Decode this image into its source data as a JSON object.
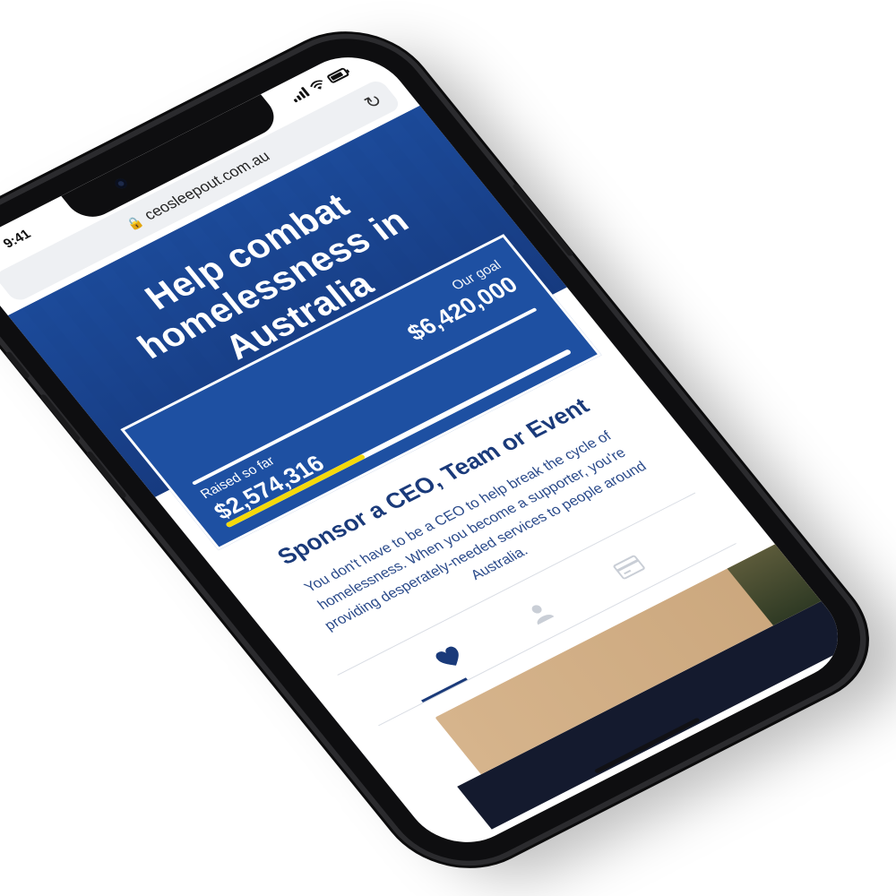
{
  "status_bar": {
    "time": "9:41"
  },
  "browser": {
    "url": "ceosleepout.com.au"
  },
  "hero": {
    "title": "Help combat homelessness in Australia"
  },
  "fundraising": {
    "goal_label": "Our goal",
    "goal_value": "$6,420,000",
    "raised_label": "Raised so far",
    "raised_value": "$2,574,316",
    "progress_fraction": 0.401,
    "progress_color": "#f5d90a",
    "card_color": "#1e50a2"
  },
  "sponsor": {
    "title": "Sponsor a CEO, Team or Event",
    "body": "You don't have to be a CEO to help break the cycle of homelessness. When you become a supporter, you're providing desperately-needed services to people around Australia."
  },
  "tabs": [
    {
      "icon": "heart-icon",
      "active": true
    },
    {
      "icon": "user-icon",
      "active": false
    },
    {
      "icon": "credit-card-icon",
      "active": false
    }
  ],
  "colors": {
    "brand_navy": "#1a3a7a",
    "hero_blue": "#1c4c9e"
  }
}
